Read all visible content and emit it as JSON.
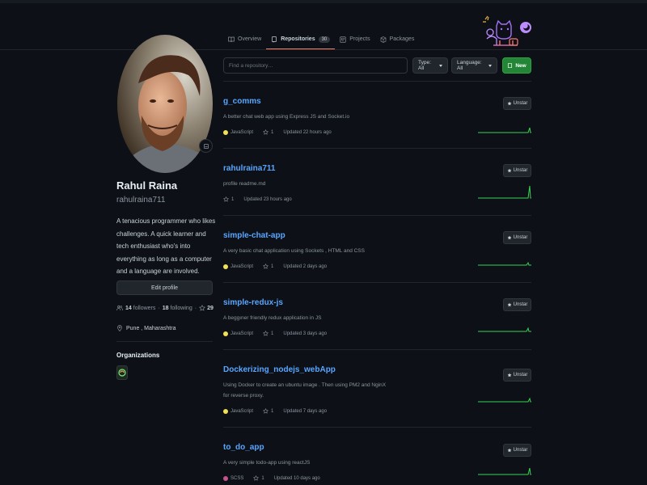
{
  "tabs": [
    {
      "label": "Overview",
      "icon": "book-icon"
    },
    {
      "label": "Repositories",
      "icon": "repo-icon",
      "count": "30",
      "active": true
    },
    {
      "label": "Projects",
      "icon": "project-icon"
    },
    {
      "label": "Packages",
      "icon": "package-icon"
    }
  ],
  "profile": {
    "full_name": "Rahul Raina",
    "username": "rahulraina711",
    "bio": "A tenacious programmer who likes challenges. A quick learner and tech enthusiast who's into everything as long as a computer and a language are involved.",
    "edit_label": "Edit profile",
    "followers_count": "14",
    "followers_label": "followers",
    "following_count": "18",
    "following_label": "following",
    "stars_count": "29",
    "separator": "·",
    "location": "Pune , Maharashtra",
    "organizations_title": "Organizations"
  },
  "filters": {
    "search_placeholder": "Find a repository…",
    "type_label": "Type: All",
    "language_label": "Language: All",
    "new_label": "New"
  },
  "colors": {
    "accent_link": "#58a6ff",
    "new_button": "#238636",
    "active_tab": "#f78166",
    "javascript": "#f1e05a",
    "scss": "#c6538c",
    "sparkline": "#39d353"
  },
  "repos": [
    {
      "name": "g_comms",
      "description": "A better chat web app using Express JS and Socket.io",
      "language": "JavaScript",
      "lang_color": "#f1e05a",
      "stars": "1",
      "updated": "Updated 22 hours ago",
      "star_label": "Unstar"
    },
    {
      "name": "rahulraina711",
      "description": "profile readme.md",
      "language": "",
      "lang_color": "",
      "stars": "1",
      "updated": "Updated 23 hours ago",
      "star_label": "Unstar"
    },
    {
      "name": "simple-chat-app",
      "description": "A very basic chat application using Sockets , HTML and CSS",
      "language": "JavaScript",
      "lang_color": "#f1e05a",
      "stars": "1",
      "updated": "Updated 2 days ago",
      "star_label": "Unstar"
    },
    {
      "name": "simple-redux-js",
      "description": "A beggıner friendly redux application in JS",
      "language": "JavaScript",
      "lang_color": "#f1e05a",
      "stars": "1",
      "updated": "Updated 3 days ago",
      "star_label": "Unstar"
    },
    {
      "name": "Dockerizing_nodejs_webApp",
      "description": "Using Docker to create an ubuntu image . Then using PM2 and NginX for reverse proxy.",
      "language": "JavaScript",
      "lang_color": "#f1e05a",
      "stars": "1",
      "updated": "Updated 7 days ago",
      "star_label": "Unstar"
    },
    {
      "name": "to_do_app",
      "description": "A very simple todo-app using reactJS",
      "language": "SCSS",
      "lang_color": "#c6538c",
      "stars": "1",
      "updated": "Updated 10 days ago",
      "star_label": "Unstar"
    }
  ]
}
